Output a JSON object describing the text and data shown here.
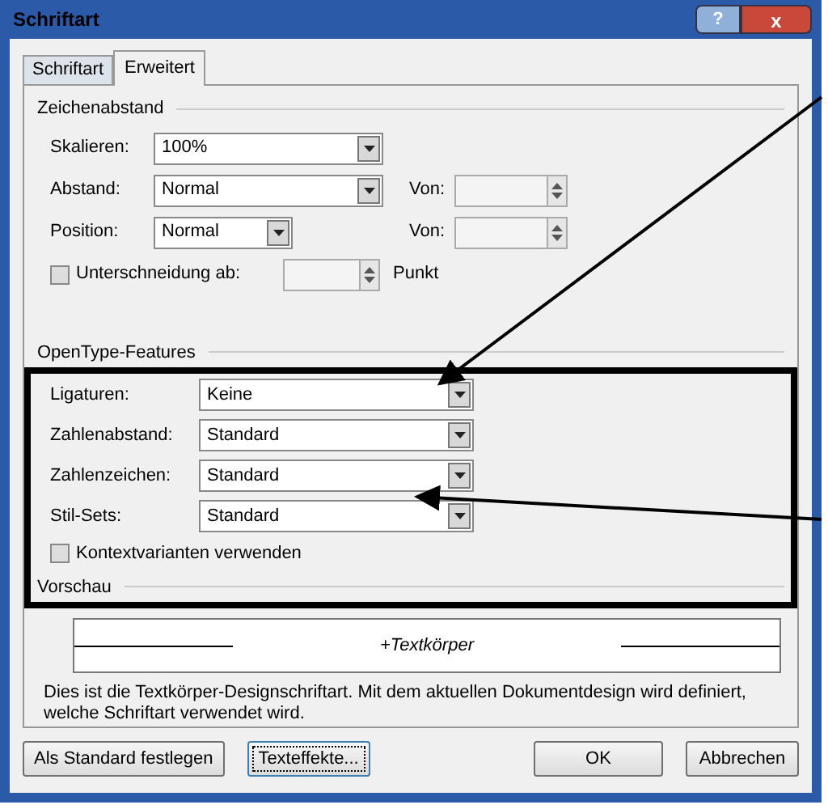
{
  "window": {
    "title": "Schriftart",
    "help": "?",
    "close": "x"
  },
  "tabs": [
    {
      "label": "Schriftart",
      "selected": false
    },
    {
      "label": "Erweitert",
      "selected": true
    }
  ],
  "character_spacing": {
    "heading": "Zeichenabstand",
    "fields": [
      {
        "kind": "dropdown",
        "label": "Skalieren:",
        "value": "100%"
      },
      {
        "kind": "dropdown_with_spin",
        "label": "Abstand:",
        "value": "Normal",
        "spin_label": "Von:"
      },
      {
        "kind": "short_dropdown_with_spin",
        "label": "Position:",
        "value": "Normal",
        "spin_label": "Von:"
      }
    ],
    "kerning": {
      "label": "Unterschneidung ab:",
      "checked": false,
      "unit": "Punkt"
    }
  },
  "opentype": {
    "heading": "OpenType-Features",
    "fields": [
      {
        "label": "Ligaturen:",
        "value": "Keine"
      },
      {
        "label": "Zahlenabstand:",
        "value": "Standard"
      },
      {
        "label": "Zahlenzeichen:",
        "value": "Standard"
      },
      {
        "label": "Stil-Sets:",
        "value": "Standard"
      }
    ],
    "contextual": {
      "label": "Kontextvarianten verwenden",
      "checked": false
    }
  },
  "preview": {
    "heading": "Vorschau",
    "sample": "+Textkörper",
    "description": "Dies ist die Textkörper-Designschriftart. Mit dem aktuellen Dokumentdesign wird definiert, welche Schriftart verwendet wird."
  },
  "buttons": [
    {
      "label": "Als Standard festlegen",
      "focused": false
    },
    {
      "label": "Texteffekte...",
      "focused": true
    },
    {
      "label": "OK",
      "focused": false
    },
    {
      "label": "Abbrechen",
      "focused": false
    }
  ]
}
